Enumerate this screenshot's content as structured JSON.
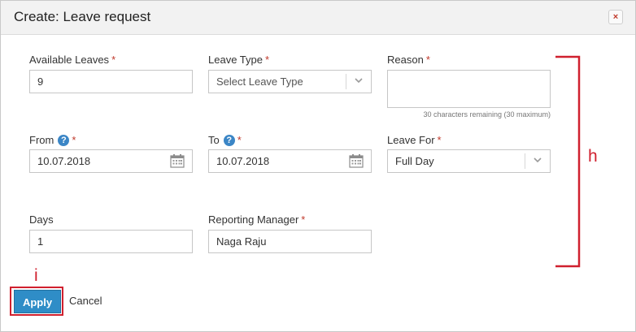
{
  "dialog": {
    "title": "Create: Leave request",
    "close_glyph": "×"
  },
  "form": {
    "available_leaves": {
      "label": "Available Leaves",
      "value": "9"
    },
    "leave_type": {
      "label": "Leave Type",
      "placeholder": "Select Leave Type"
    },
    "reason": {
      "label": "Reason",
      "value": "",
      "hint": "30 characters remaining (30 maximum)"
    },
    "from": {
      "label": "From",
      "value": "10.07.2018"
    },
    "to": {
      "label": "To",
      "value": "10.07.2018"
    },
    "leave_for": {
      "label": "Leave For",
      "value": "Full Day"
    },
    "days": {
      "label": "Days",
      "value": "1"
    },
    "reporting_manager": {
      "label": "Reporting Manager",
      "value": "Naga Raju"
    },
    "required_mark": "*",
    "help_glyph": "?"
  },
  "footer": {
    "apply_label": "Apply",
    "cancel_label": "Cancel"
  },
  "annotations": {
    "callout_h": "h",
    "callout_i": "i",
    "color": "#d0202e"
  },
  "colors": {
    "primary_button": "#2f8dc7",
    "required": "#c0392b",
    "help_icon": "#3b86c6"
  }
}
